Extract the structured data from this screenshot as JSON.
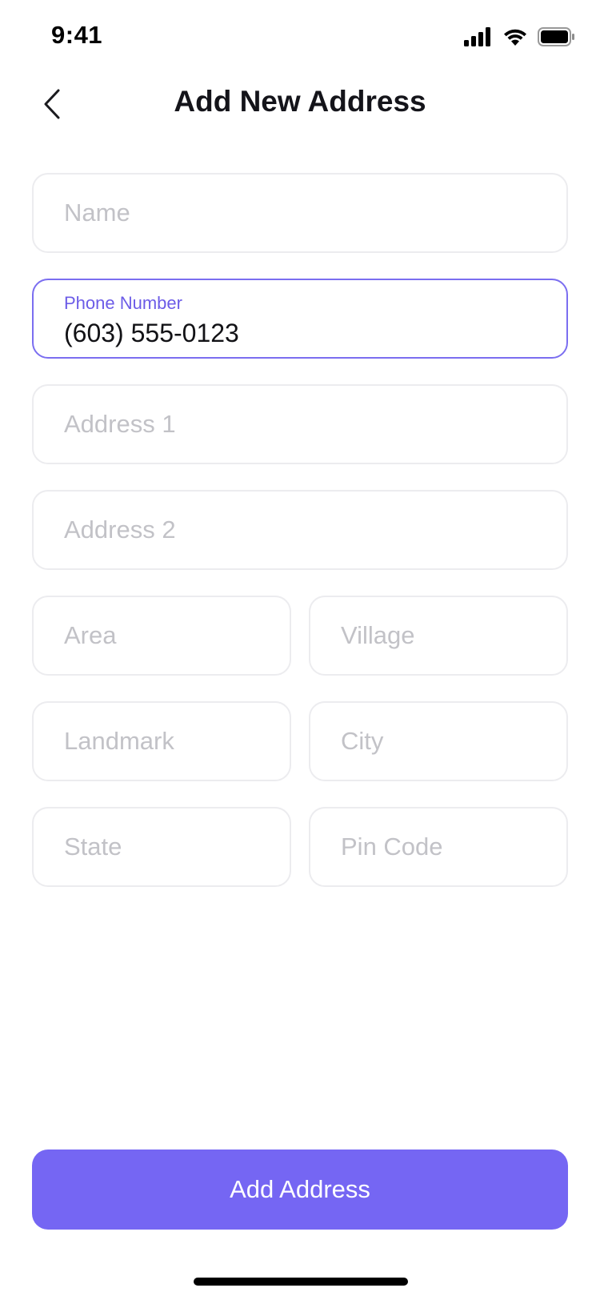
{
  "status_bar": {
    "time": "9:41",
    "icons": [
      "signal-icon",
      "wifi-icon",
      "battery-icon"
    ]
  },
  "header": {
    "back_icon": "chevron-left-icon",
    "title": "Add New Address"
  },
  "form": {
    "name": {
      "placeholder": "Name",
      "value": ""
    },
    "phone": {
      "label": "Phone Number",
      "value": "(603) 555-0123"
    },
    "address1": {
      "placeholder": "Address 1",
      "value": ""
    },
    "address2": {
      "placeholder": "Address 2",
      "value": ""
    },
    "area": {
      "placeholder": "Area",
      "value": ""
    },
    "village": {
      "placeholder": "Village",
      "value": ""
    },
    "landmark": {
      "placeholder": "Landmark",
      "value": ""
    },
    "city": {
      "placeholder": "City",
      "value": ""
    },
    "state": {
      "placeholder": "State",
      "value": ""
    },
    "pin_code": {
      "placeholder": "Pin Code",
      "value": ""
    }
  },
  "actions": {
    "submit_label": "Add Address"
  },
  "colors": {
    "accent": "#7566f3",
    "active_border": "#7b6ef0",
    "field_border": "#ececef",
    "placeholder": "#c2c2c7",
    "title": "#14141a"
  }
}
